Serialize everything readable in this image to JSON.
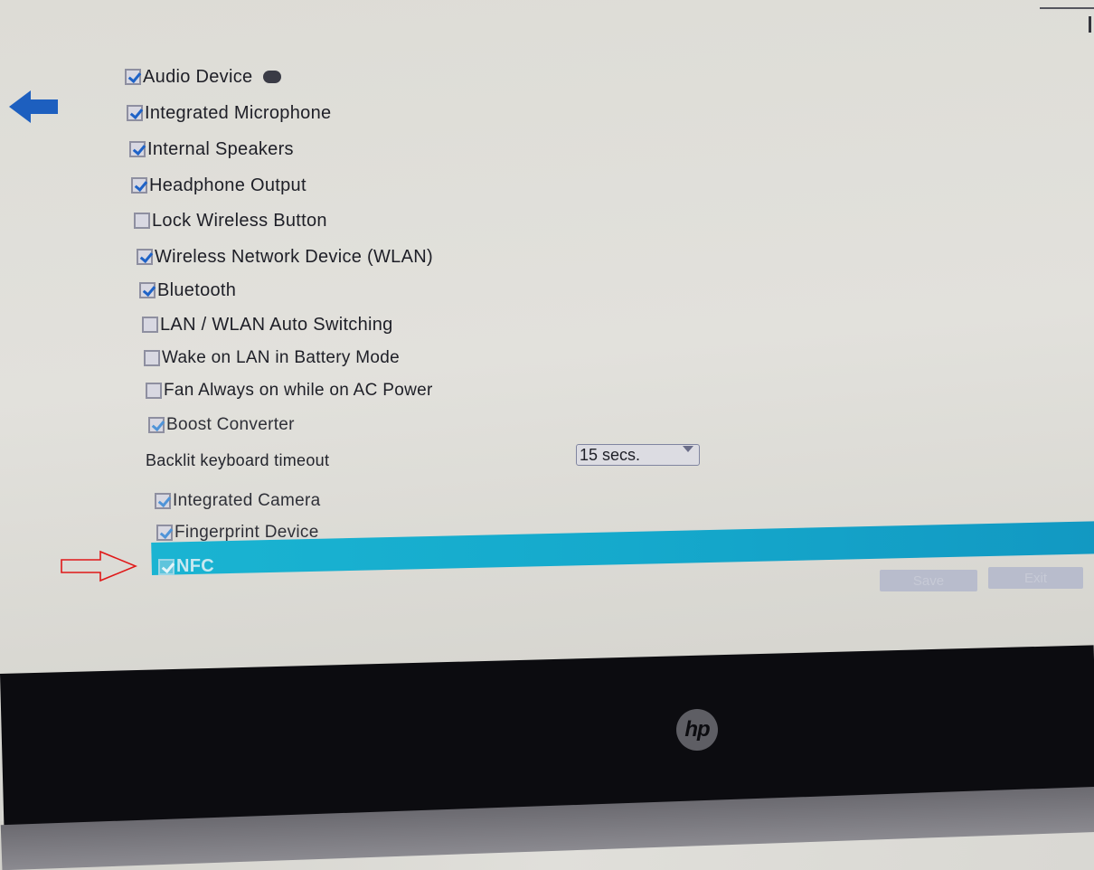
{
  "screen": {
    "back_icon": "arrow-left-icon",
    "items": [
      {
        "label": "Audio Device",
        "checked": true,
        "info_icon": "info-icon"
      },
      {
        "label": "Integrated Microphone",
        "checked": true
      },
      {
        "label": "Internal Speakers",
        "checked": true
      },
      {
        "label": "Headphone Output",
        "checked": true
      },
      {
        "label": "Lock Wireless Button",
        "checked": false
      },
      {
        "label": "Wireless Network Device (WLAN)",
        "checked": true
      },
      {
        "label": "Bluetooth",
        "checked": true
      },
      {
        "label": "LAN / WLAN Auto Switching",
        "checked": false
      },
      {
        "label": "Wake on LAN in Battery Mode",
        "checked": false
      },
      {
        "label": "Fan Always on while on AC Power",
        "checked": false
      },
      {
        "label": "Boost Converter",
        "checked": true
      }
    ],
    "backlit": {
      "label": "Backlit keyboard timeout",
      "value": "15 secs."
    },
    "items2": [
      {
        "label": "Integrated Camera",
        "checked": true
      },
      {
        "label": "Fingerprint Device",
        "checked": true
      },
      {
        "label": "NFC",
        "checked": true,
        "selected": true
      }
    ],
    "annotation": "red-outline-arrow pointing at NFC",
    "buttons": {
      "save": "Save",
      "exit": "Exit"
    },
    "highlight_color": "#15a9cc"
  },
  "hardware": {
    "logo": "hp"
  }
}
